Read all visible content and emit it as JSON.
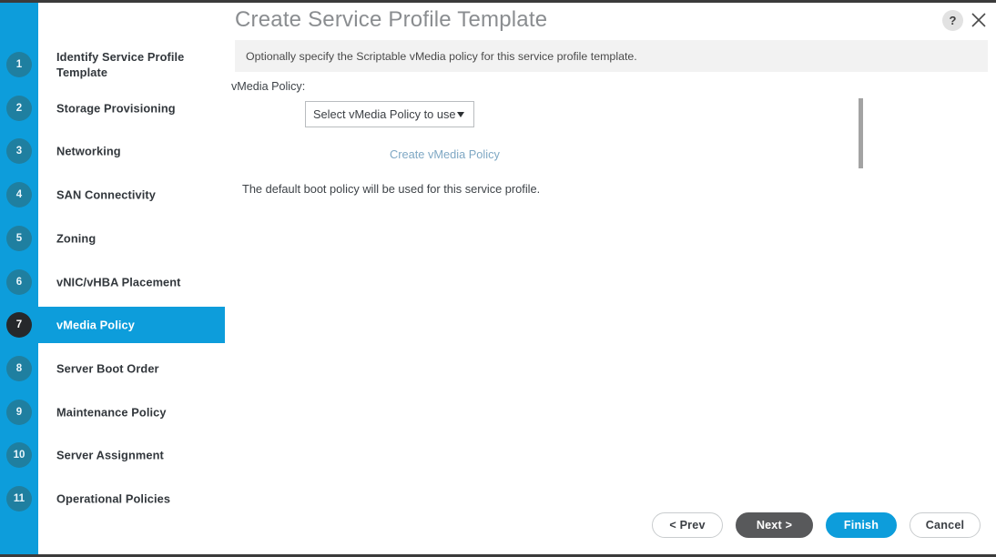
{
  "window": {
    "title": "Create Service Profile Template",
    "help_label": "?",
    "close_icon": "close-icon"
  },
  "instruction": {
    "text": "Optionally specify the Scriptable vMedia policy for this service profile template."
  },
  "sidebar": {
    "steps": [
      {
        "number": "1",
        "label": "Identify Service Profile Template",
        "active": false
      },
      {
        "number": "2",
        "label": "Storage Provisioning",
        "active": false
      },
      {
        "number": "3",
        "label": "Networking",
        "active": false
      },
      {
        "number": "4",
        "label": "SAN Connectivity",
        "active": false
      },
      {
        "number": "5",
        "label": "Zoning",
        "active": false
      },
      {
        "number": "6",
        "label": "vNIC/vHBA Placement",
        "active": false
      },
      {
        "number": "7",
        "label": "vMedia Policy",
        "active": true
      },
      {
        "number": "8",
        "label": "Server Boot Order",
        "active": false
      },
      {
        "number": "9",
        "label": "Maintenance Policy",
        "active": false
      },
      {
        "number": "10",
        "label": "Server Assignment",
        "active": false
      },
      {
        "number": "11",
        "label": "Operational Policies",
        "active": false
      }
    ]
  },
  "form": {
    "vmedia_policy_label": "vMedia Policy:",
    "vmedia_policy_value": "Select vMedia Policy to use",
    "create_policy_link": "Create vMedia Policy",
    "boot_policy_note": "The default boot policy will be used for this service profile."
  },
  "footer": {
    "buttons": [
      {
        "label": "< Prev",
        "style": "outline"
      },
      {
        "label": "Next >",
        "style": "dark"
      },
      {
        "label": "Finish",
        "style": "primary"
      },
      {
        "label": "Cancel",
        "style": "outline"
      }
    ]
  },
  "colors": {
    "accent_blue": "#0d9ddb",
    "rail_badge": "#1f7fa0",
    "active_badge": "#26282b",
    "dark_button": "#58595b",
    "link_blue": "#7fa8c4",
    "instruction_bg": "#f2f2f2"
  }
}
